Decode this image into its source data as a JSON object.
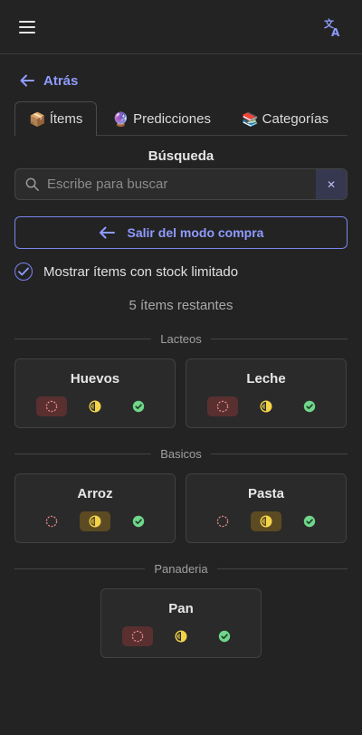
{
  "header": {
    "menu_icon": "hamburger-icon",
    "translate_icon": "translate-icon"
  },
  "nav": {
    "back_label": "Atrás"
  },
  "tabs": [
    {
      "emoji": "📦",
      "label": "Ítems",
      "active": true
    },
    {
      "emoji": "🔮",
      "label": "Predicciones",
      "active": false
    },
    {
      "emoji": "📚",
      "label": "Categorías",
      "active": false
    }
  ],
  "search": {
    "label": "Búsqueda",
    "placeholder": "Escribe para buscar",
    "value": "",
    "clear": "✕"
  },
  "exit_button": {
    "label": "Salir del modo compra"
  },
  "stock_filter": {
    "label": "Mostrar ítems con stock limitado",
    "checked": true
  },
  "remaining": "5 ítems restantes",
  "groups": [
    {
      "name": "Lacteos",
      "items": [
        {
          "name": "Huevos",
          "selected": "empty"
        },
        {
          "name": "Leche",
          "selected": "empty"
        }
      ]
    },
    {
      "name": "Basicos",
      "items": [
        {
          "name": "Arroz",
          "selected": "half"
        },
        {
          "name": "Pasta",
          "selected": "half"
        }
      ]
    },
    {
      "name": "Panaderia",
      "items": [
        {
          "name": "Pan",
          "selected": "empty"
        }
      ]
    }
  ],
  "colors": {
    "accent": "#8f9bff",
    "empty": "#e88a8a",
    "half": "#f2d34a",
    "full": "#6fd68a"
  }
}
